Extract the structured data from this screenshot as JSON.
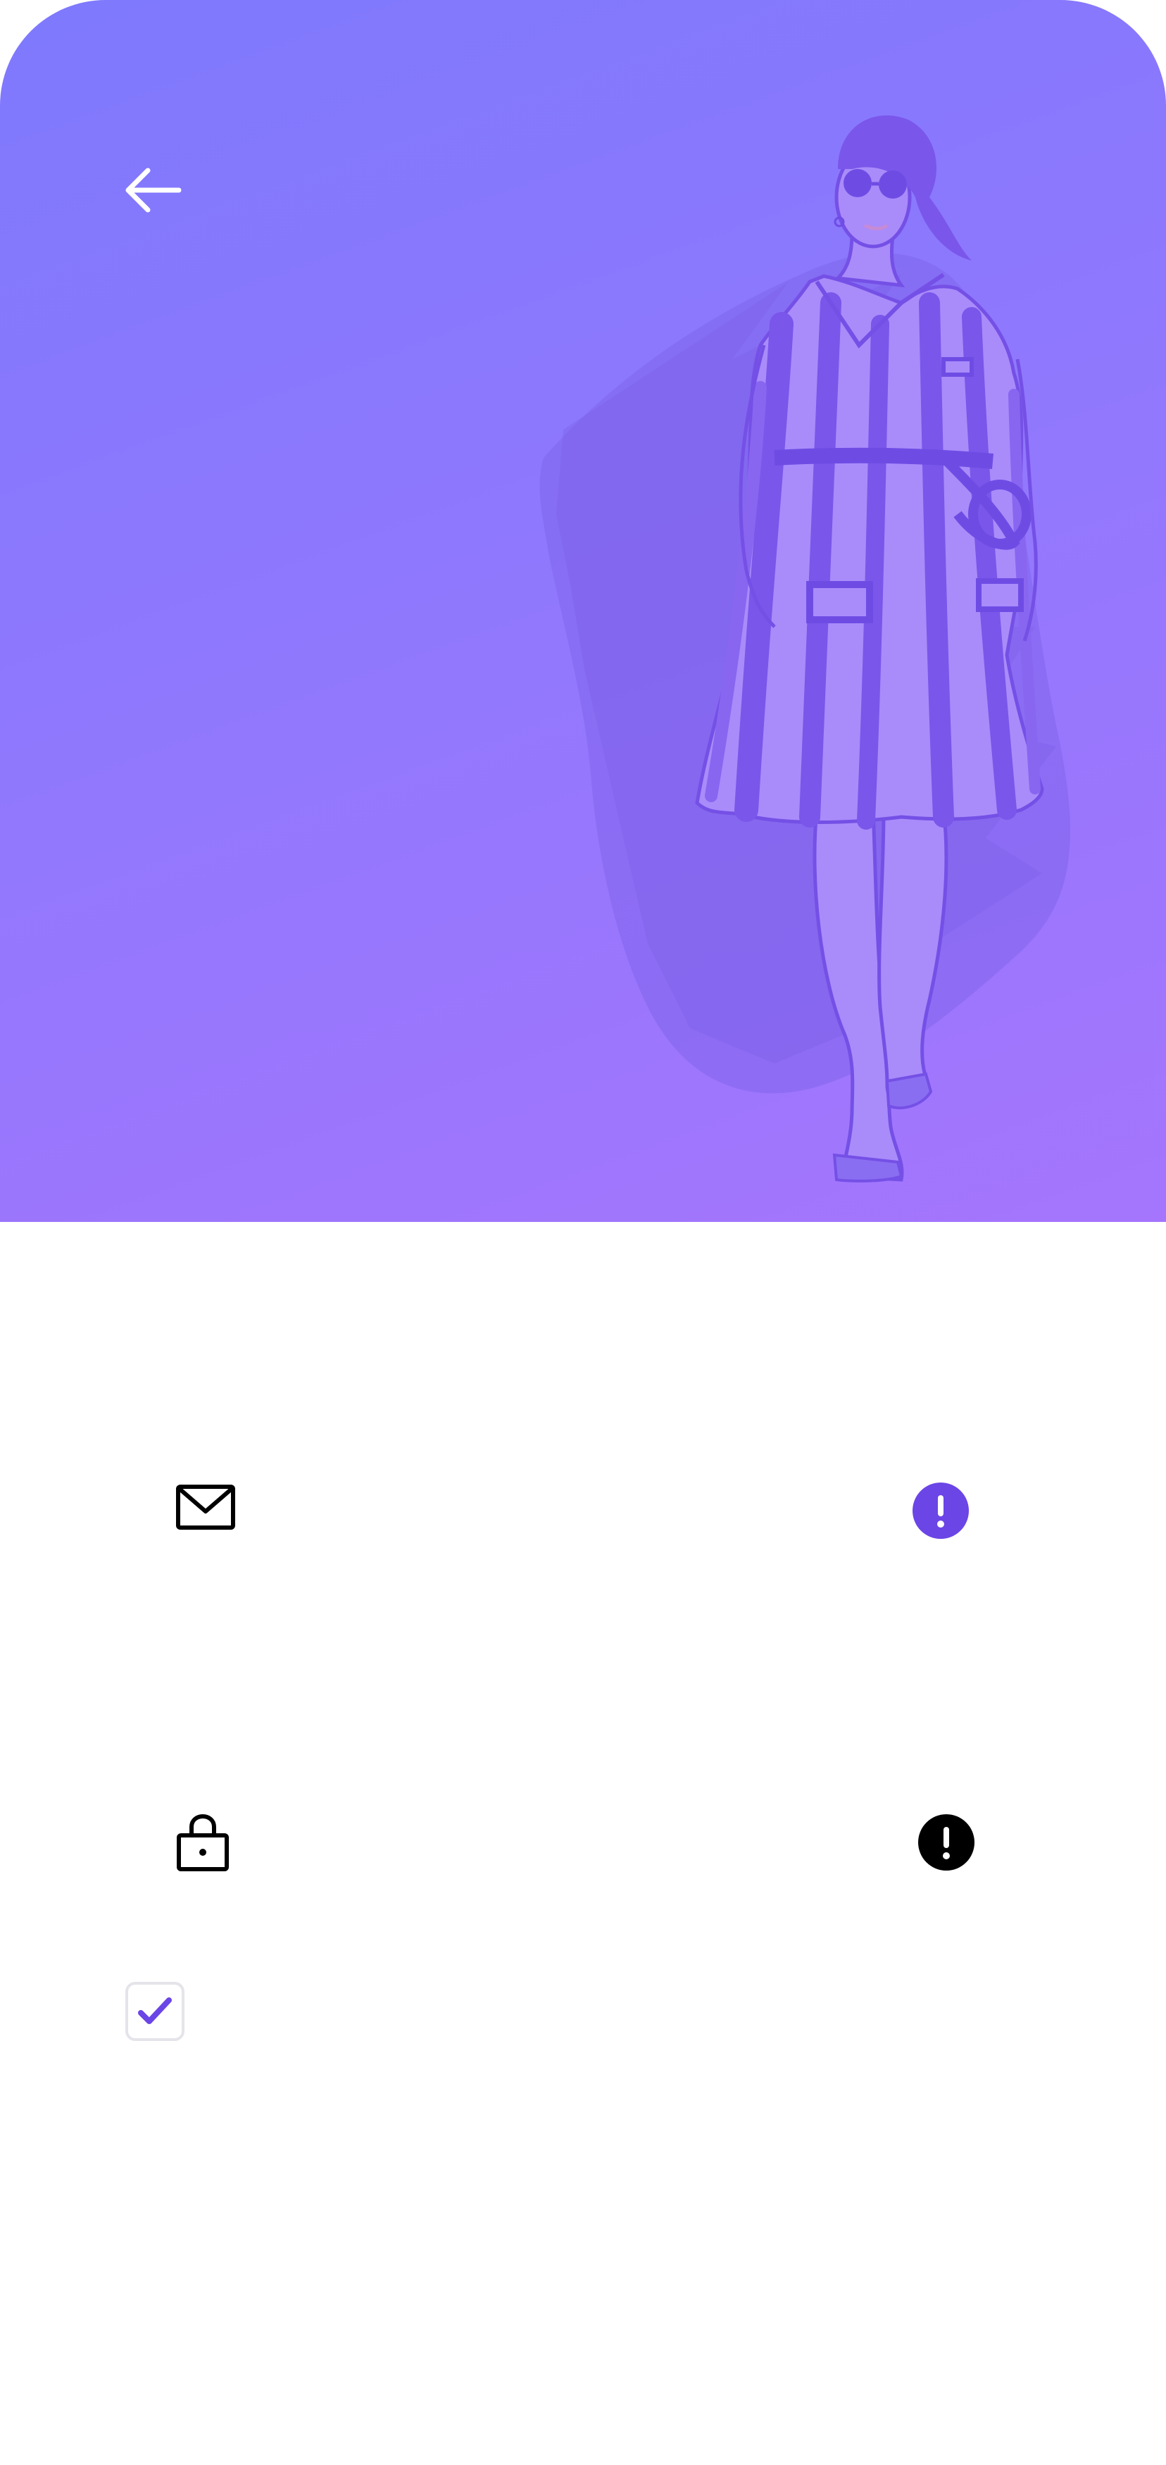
{
  "screen": {
    "background": "#ffffff"
  },
  "hero": {
    "gradient_start": "#7e79fd",
    "gradient_end": "#a575fd",
    "illustration": "fashion-model-striped-dress-illustration"
  },
  "header": {
    "back_icon": "arrow-left-icon",
    "back_icon_color": "#ffffff"
  },
  "form": {
    "email": {
      "icon": "mail-icon",
      "status_icon": "alert-circle-icon",
      "status_color": "#6b45e6"
    },
    "password": {
      "icon": "lock-icon",
      "status_icon": "alert-circle-icon",
      "status_color": "#000000"
    },
    "remember": {
      "checked": true,
      "check_color": "#6b45e6"
    }
  }
}
